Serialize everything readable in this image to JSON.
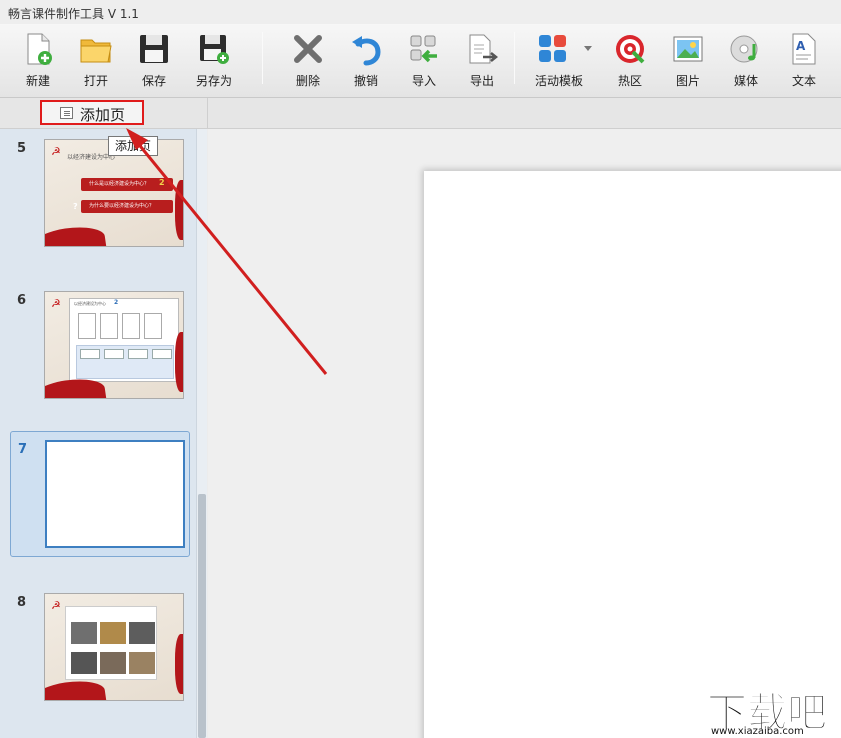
{
  "window": {
    "title": "畅言课件制作工具 V 1.1"
  },
  "toolbar": {
    "items": [
      {
        "id": "new",
        "label": "新建",
        "icon": "new-file-icon"
      },
      {
        "id": "open",
        "label": "打开",
        "icon": "folder-open-icon"
      },
      {
        "id": "save",
        "label": "保存",
        "icon": "floppy-disk-icon"
      },
      {
        "id": "save_as",
        "label": "另存为",
        "icon": "floppy-save-as-icon"
      },
      {
        "id": "delete",
        "label": "删除",
        "icon": "delete-x-icon"
      },
      {
        "id": "undo",
        "label": "撤销",
        "icon": "undo-icon"
      },
      {
        "id": "import",
        "label": "导入",
        "icon": "import-icon"
      },
      {
        "id": "export",
        "label": "导出",
        "icon": "export-icon"
      },
      {
        "id": "activity_template",
        "label": "活动模板",
        "icon": "template-grid-icon"
      },
      {
        "id": "hotspot",
        "label": "热区",
        "icon": "target-icon"
      },
      {
        "id": "image",
        "label": "图片",
        "icon": "picture-icon"
      },
      {
        "id": "media",
        "label": "媒体",
        "icon": "media-disc-icon"
      },
      {
        "id": "text",
        "label": "文本",
        "icon": "text-document-icon"
      }
    ]
  },
  "subbar": {
    "add_page_label": "添加页",
    "tooltip": "添加页"
  },
  "slides": [
    {
      "number": "5",
      "selected": false,
      "title": "以经济建设为中心",
      "bar1": "什么是以经济建设为中心？",
      "bar2": "为什么要以经济建设为中心？",
      "mark1": "2",
      "mark2": "?"
    },
    {
      "number": "6",
      "selected": false,
      "title": "以经济建设为中心",
      "mark": "2"
    },
    {
      "number": "7",
      "selected": true
    },
    {
      "number": "8",
      "selected": false
    }
  ],
  "watermark": {
    "big": "下载吧",
    "small": "www.xiazaiba.com"
  },
  "colors": {
    "highlight": "#e01b1b",
    "accent_blue": "#3d7fc1",
    "party_red": "#b3161a"
  }
}
